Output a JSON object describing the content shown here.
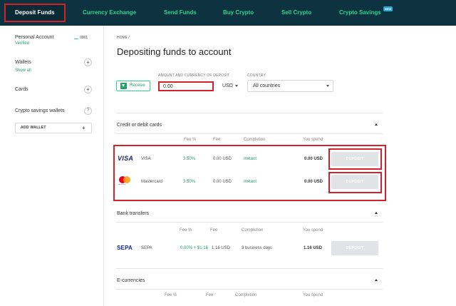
{
  "nav": {
    "items": [
      {
        "label": "Deposit Funds",
        "active": true
      },
      {
        "label": "Currency Exchange"
      },
      {
        "label": "Send Funds"
      },
      {
        "label": "Buy Crypto"
      },
      {
        "label": "Sell Crypto"
      },
      {
        "label": "Crypto Savings",
        "badge": "NEW"
      }
    ]
  },
  "sidebar": {
    "account_label": "Personal Account",
    "account_status": "Verified",
    "account_id": "0001",
    "wallets_label": "Wallets",
    "show_all": "Show all",
    "cards_label": "Cards",
    "crypto_savings_label": "Crypto savings wallets",
    "help_icon_text": "?",
    "add_wallet": "ADD WALLET",
    "plus": "+"
  },
  "main": {
    "breadcrumb": "HOME /",
    "title": "Depositing funds to account",
    "receive_label": "Receive",
    "amount_label": "AMOUNT AND CURRENCY OF DEPOSIT",
    "amount_value": "0.00",
    "currency": "USD",
    "country_label": "COUNTRY",
    "country_value": "All countries"
  },
  "sections": {
    "cards": {
      "title": "Credit or debit cards",
      "headers": {
        "fee_pct": "Fee %",
        "fee": "Fee",
        "completion": "Completion",
        "you_spend": "You spend"
      },
      "rows": [
        {
          "logo": "VISA",
          "name": "VISA",
          "fee_pct": "3.50%",
          "fee": "0.00 USD",
          "completion": "Instant",
          "spend": "0.00 USD",
          "action": "DEPOSIT"
        },
        {
          "logo": "mastercard",
          "name": "Mastercard",
          "fee_pct": "3.50%",
          "fee": "0.00 USD",
          "completion": "Instant",
          "spend": "0.00 USD",
          "action": "DEPOSIT"
        }
      ]
    },
    "bank": {
      "title": "Bank transfers",
      "headers": {
        "fee_pct": "Fee %",
        "fee": "Fee",
        "completion": "Completion",
        "you_spend": "You spend"
      },
      "rows": [
        {
          "logo": "SEPA",
          "name": "SEPA",
          "fee_pct": "0.00% + $1.16",
          "fee": "1.16 USD",
          "completion": "3 business days",
          "spend": "1.16 USD",
          "action": "DEPOSIT"
        }
      ]
    },
    "ecurrencies": {
      "title": "E-currencies",
      "headers": {
        "fee_pct": "Fee %",
        "fee": "Fee",
        "completion": "Completion",
        "you_spend": "You spend"
      }
    }
  },
  "colors": {
    "nav_bg": "#0d3340",
    "accent_green": "#2fd38f",
    "highlight_red": "#d4222a",
    "button_disabled": "#e0e4e6"
  }
}
